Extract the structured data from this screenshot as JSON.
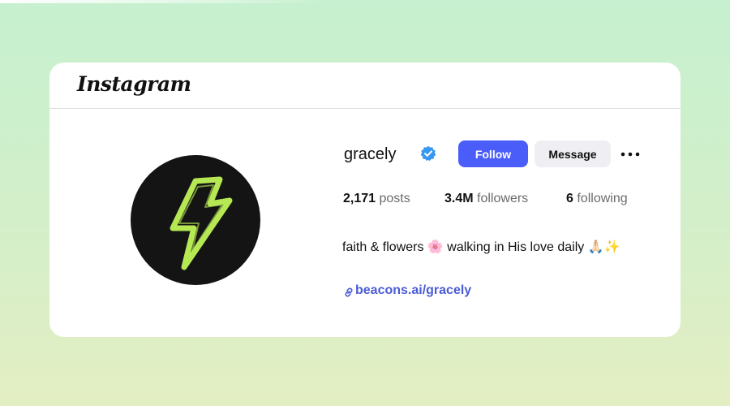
{
  "app": {
    "logo_text": "Instagram"
  },
  "profile": {
    "username": "gracely",
    "verified_icon": "verified-badge-icon",
    "avatar_icon": "lightning-bolt-icon",
    "actions": {
      "follow_label": "Follow",
      "message_label": "Message",
      "more_icon": "more-options-icon"
    },
    "stats": {
      "posts_count": "2,171",
      "posts_label": "posts",
      "followers_count": "3.4M",
      "followers_label": "followers",
      "following_count": "6",
      "following_label": "following"
    },
    "bio": "faith & flowers 🌸 walking in His love daily 🙏🏻✨",
    "link": {
      "icon": "link-icon",
      "text": "beacons.ai/gracely"
    }
  },
  "colors": {
    "follow_button": "#4a5df9",
    "message_button": "#efeff3",
    "link": "#4a5cd6",
    "verified_badge": "#3897f0",
    "avatar_background": "#141414",
    "bolt": "#b6e854"
  }
}
